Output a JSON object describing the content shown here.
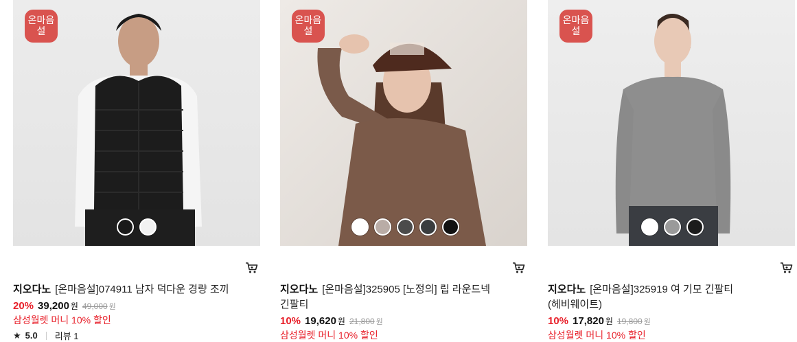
{
  "products": [
    {
      "badge": {
        "line1": "온마음",
        "line2": "설"
      },
      "brand": "지오다노",
      "title": "[온마음설]074911 남자 덕다운 경량 조끼",
      "discount": "20%",
      "price": "39,200",
      "currency": "원",
      "original_price": "49,000",
      "promo": "삼성월렛 머니 10% 할인",
      "rating": "5.0",
      "reviews": "리뷰 1",
      "swatch_colors": [
        "#1a1a1a",
        "#f2f2f2"
      ]
    },
    {
      "badge": {
        "line1": "온마음",
        "line2": "설"
      },
      "brand": "지오다노",
      "title": "[온마음설]325905 [노정의] 립 라운드넥 긴팔티",
      "discount": "10%",
      "price": "19,620",
      "currency": "원",
      "original_price": "21,800",
      "promo": "삼성월렛 머니 10% 할인",
      "swatch_colors": [
        "#ffffff",
        "#b9aca6",
        "#4b4b4b",
        "#3a3d3f",
        "#111111"
      ]
    },
    {
      "badge": {
        "line1": "온마음",
        "line2": "설"
      },
      "brand": "지오다노",
      "title": "[온마음설]325919 여 기모 긴팔티 (헤비웨이트)",
      "discount": "10%",
      "price": "17,820",
      "currency": "원",
      "original_price": "19,800",
      "promo": "삼성월렛 머니 10% 할인",
      "swatch_colors": [
        "#ffffff",
        "#9a9a9a",
        "#1c1c1c"
      ]
    }
  ],
  "icons": {
    "cart": "cart-icon",
    "star": "star-icon"
  },
  "colors": {
    "sale": "#e8202a",
    "badge": "#d9534f"
  }
}
